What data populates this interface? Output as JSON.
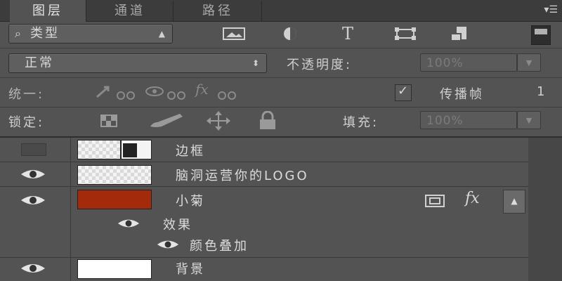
{
  "tabs": [
    {
      "label": "图层",
      "active": true
    },
    {
      "label": "通道",
      "active": false
    },
    {
      "label": "路径",
      "active": false
    }
  ],
  "filter": {
    "search_icon": "search-icon",
    "type_label": "类型",
    "filter_icons": [
      "image-filter-icon",
      "adjustment-filter-icon",
      "text-filter-icon",
      "shape-filter-icon",
      "smart-object-filter-icon"
    ]
  },
  "blend": {
    "mode": "正常",
    "opacity_label": "不透明度:",
    "opacity_value": "100%"
  },
  "unify": {
    "label": "统一:",
    "propagate_label": "传播帧",
    "propagate_value": "1",
    "propagate_checked": true
  },
  "lock": {
    "label": "锁定:",
    "fill_label": "填充:",
    "fill_value": "100%"
  },
  "layers": [
    {
      "name": "边框",
      "visible": false,
      "thumb": "checker-smart"
    },
    {
      "name": "脑洞运营你的LOGO",
      "visible": true,
      "thumb": "checker"
    },
    {
      "name": "小菊",
      "visible": true,
      "thumb": "red",
      "fx_label": "fx",
      "effects_label": "效果",
      "effect_name": "颜色叠加"
    },
    {
      "name": "背景",
      "visible": true,
      "thumb": "white"
    }
  ],
  "colors": {
    "red_thumb": "#a32a0a",
    "panel": "#535353",
    "tabbar": "#3c3c3c"
  }
}
